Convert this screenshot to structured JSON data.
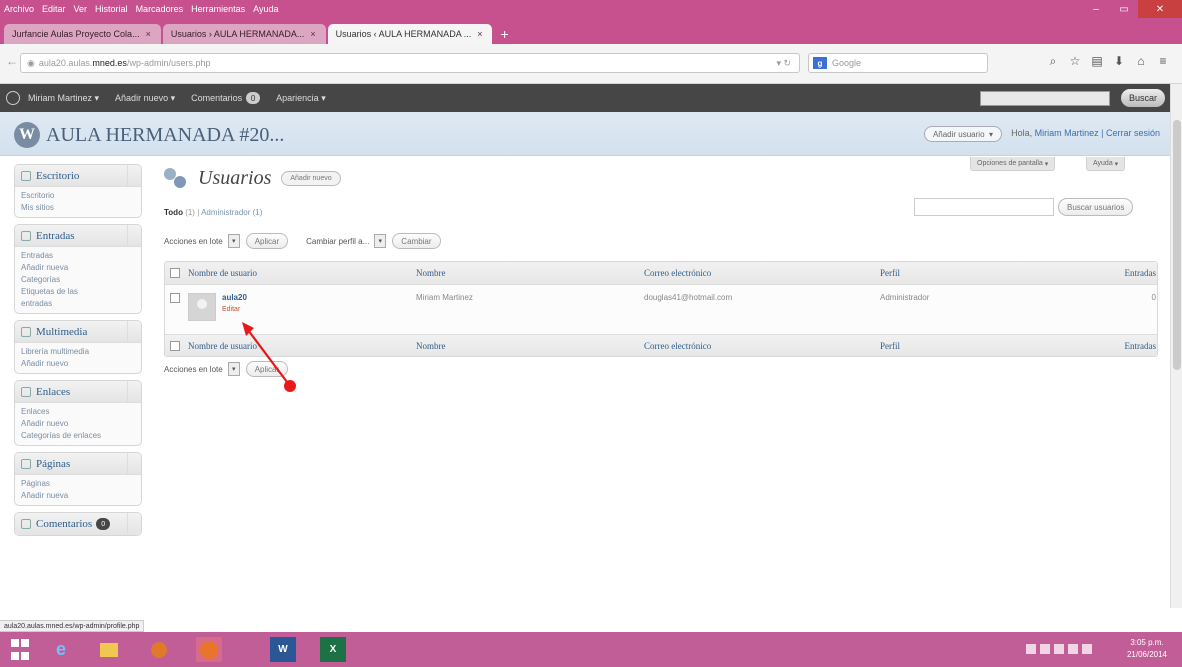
{
  "browser": {
    "menu": [
      "Archivo",
      "Editar",
      "Ver",
      "Historial",
      "Marcadores",
      "Herramientas",
      "Ayuda"
    ],
    "tabs": [
      {
        "label": "Jurfancie Aulas Proyecto Cola..."
      },
      {
        "label": "Usuarios › AULA HERMANADA..."
      },
      {
        "label": "Usuarios ‹ AULA HERMANADA ..."
      }
    ],
    "url_prefix": "aula20.aulas.",
    "url_domain": "mned.es",
    "url_path": "/wp-admin/users.php",
    "search_placeholder": "Google",
    "new_tab": "+"
  },
  "adminbar": {
    "user": "Miriam Martinez",
    "add_new": "Añadir nuevo",
    "comments": "Comentarios",
    "comments_count": "0",
    "appearance": "Apariencia",
    "search_button": "Buscar"
  },
  "header": {
    "site_title": "AULA HERMANADA #20...",
    "favorite_action": "Añadir usuario",
    "greeting": "Hola,",
    "user_name": "Miriam Martinez",
    "logout": "| Cerrar sesión",
    "screen_options": "Opciones de pantalla",
    "help": "Ayuda"
  },
  "sidebar": {
    "groups": [
      {
        "title": "Escritorio",
        "items": [
          "Escritorio",
          "Mis sitios"
        ]
      },
      {
        "title": "Entradas",
        "items": [
          "Entradas",
          "Añadir nueva",
          "Categorías",
          "Etiquetas de las",
          "entradas"
        ]
      },
      {
        "title": "Multimedia",
        "items": [
          "Librería multimedia",
          "Añadir nuevo"
        ]
      },
      {
        "title": "Enlaces",
        "items": [
          "Enlaces",
          "Añadir nuevo",
          "Categorías de enlaces"
        ]
      },
      {
        "title": "Páginas",
        "items": [
          "Páginas",
          "Añadir nueva"
        ]
      }
    ],
    "comments_label": "Comentarios",
    "comments_count": "0"
  },
  "main": {
    "title": "Usuarios",
    "add_new": "Añadir nuevo",
    "filter_all": "Todo",
    "filter_all_count": "(1)",
    "filter_sep": "|",
    "filter_admin": "Administrador (1)",
    "search_button": "Buscar usuarios",
    "bulk_label": "Acciones en lote",
    "apply": "Aplicar",
    "change_role": "Cambiar perfil a...",
    "change": "Cambiar",
    "columns": [
      "Nombre de usuario",
      "Nombre",
      "Correo electrónico",
      "Perfil",
      "Entradas"
    ],
    "users": [
      {
        "login": "aula20",
        "edit": "Editar",
        "name": "Miriam Martinez",
        "email": "douglas41@hotmail.com",
        "role": "Administrador",
        "posts": "0"
      }
    ]
  },
  "statusbar": "aula20.aulas.mned.es/wp-admin/profile.php",
  "clock": {
    "time": "3:05 p.m.",
    "date": "21/06/2014"
  },
  "colors": {
    "accent": "#c7518f",
    "taskbar": "#c25e97",
    "annotation": "#e81919",
    "link": "#2f5d8b"
  }
}
